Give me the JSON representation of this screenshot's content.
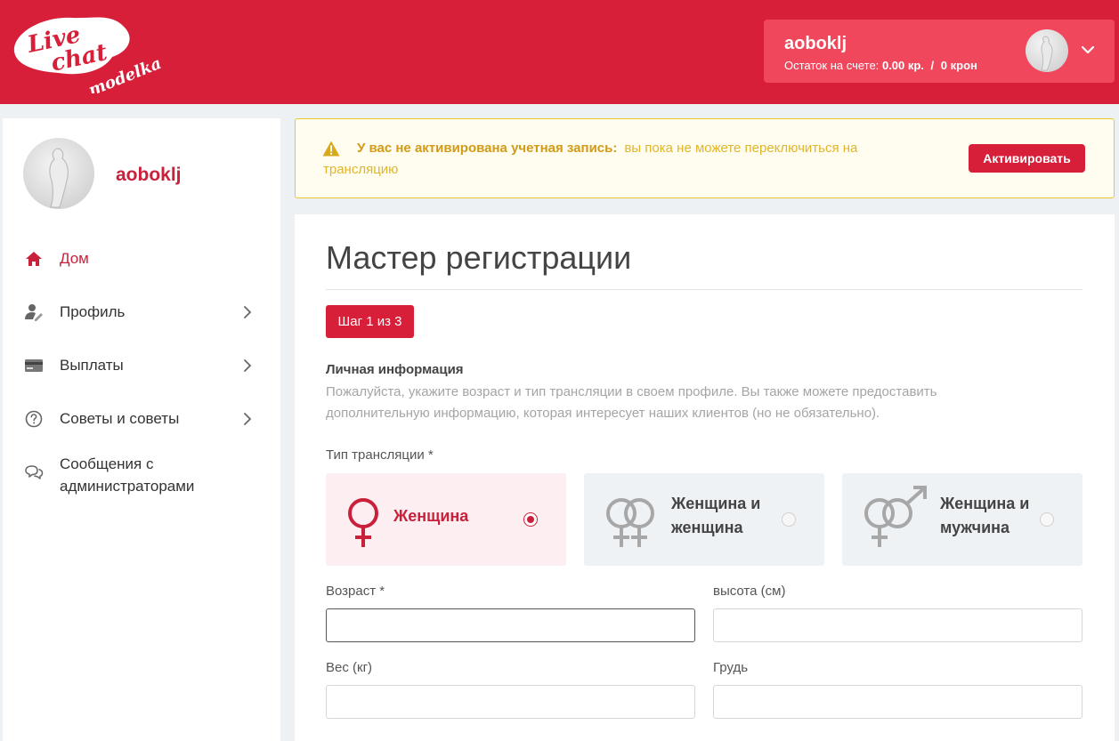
{
  "header": {
    "logo_text": [
      "Live",
      "chat",
      "modelka"
    ],
    "account": {
      "username": "aoboklj",
      "balance_prefix": "Остаток на счете:",
      "balance_value": "0.00 кр.",
      "separator": "/",
      "crowns": "0 крон"
    }
  },
  "sidebar": {
    "username": "aoboklj",
    "items": [
      {
        "label": "Дом",
        "icon": "home-icon",
        "active": true,
        "has_submenu": false
      },
      {
        "label": "Профиль",
        "icon": "user-edit-icon",
        "active": false,
        "has_submenu": true
      },
      {
        "label": "Выплаты",
        "icon": "credit-card-icon",
        "active": false,
        "has_submenu": true
      },
      {
        "label": "Советы и советы",
        "icon": "question-circle-icon",
        "active": false,
        "has_submenu": true
      },
      {
        "label": "Сообщения с администраторами",
        "icon": "chat-bubbles-icon",
        "active": false,
        "has_submenu": false
      }
    ]
  },
  "alert": {
    "bold": "У вас не активирована учетная запись:",
    "text": "вы пока не можете переключиться на трансляцию",
    "button": "Активировать"
  },
  "wizard": {
    "title": "Мастер регистрации",
    "step": "Шаг 1 из 3",
    "section_title": "Личная информация",
    "section_desc": "Пожалуйста, укажите возраст и тип трансляции в своем профиле. Вы также можете предоставить дополнительную информацию, которая интересует наших клиентов (но не обязательно).",
    "stream_type_label": "Тип трансляции *",
    "stream_options": [
      {
        "label": "Женщина",
        "icon": "female-symbol-icon",
        "selected": true
      },
      {
        "label": "Женщина и женщина",
        "icon": "double-female-icon",
        "selected": false
      },
      {
        "label": "Женщина и мужчина",
        "icon": "female-male-icon",
        "selected": false
      }
    ],
    "fields": {
      "age_label": "Возраст *",
      "age_value": "",
      "height_label": "высота (см)",
      "height_value": "",
      "weight_label": "Вес (кг)",
      "weight_value": "",
      "chest_label": "Грудь",
      "chest_value": ""
    }
  },
  "colors": {
    "brand_red": "#d71f3a",
    "alert_border": "#e6c82f",
    "alert_text": "#e1b52a"
  }
}
